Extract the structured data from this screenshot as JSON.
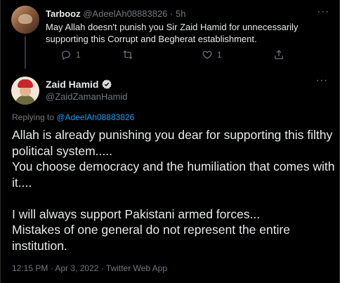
{
  "parent_tweet": {
    "name": "Tarbooz",
    "handle": "@AdeelAh08883826",
    "separator": "·",
    "time": "5h",
    "text": "May Allah doesn't punish you Sir Zaid Hamid for unnecessarily supporting this Corrupt and Begherat establishment.",
    "replies": "1",
    "likes": "1"
  },
  "main_tweet": {
    "name": "Zaid Hamid",
    "handle": "@ZaidZamanHamid",
    "replying_prefix": "Replying to",
    "replying_handle": "@AdeelAh08883826",
    "text": "Allah is already punishing you dear for supporting this filthy political system.....\nYou choose democracy and the humiliation that comes with it....\n\nI will always support Pakistani armed forces...\nMistakes of one general do not represent the entire institution.",
    "meta": "12:15 PM · Apr 3, 2022 · Twitter Web App"
  },
  "icons": {
    "more": "more-dots-icon",
    "reply": "reply-icon",
    "retweet": "retweet-icon",
    "like": "heart-icon",
    "share": "share-icon",
    "verified": "verified-badge-icon"
  },
  "colors": {
    "background": "#000000",
    "text": "#e7e9ea",
    "muted": "#71767b",
    "accent": "#1d9bf0"
  }
}
